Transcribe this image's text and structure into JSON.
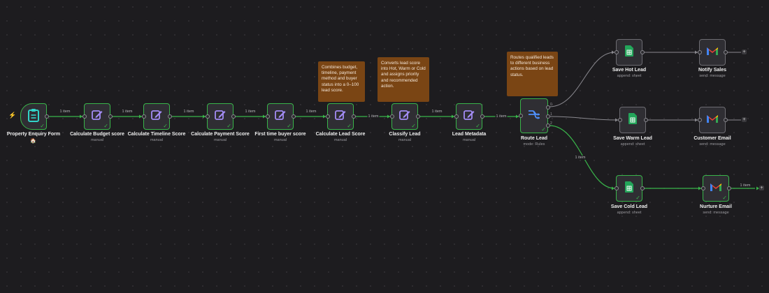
{
  "nodes": {
    "trigger": {
      "label": "Property Enquiry Form",
      "sub": "🏠",
      "icon": "clipboard-icon"
    },
    "budget": {
      "label": "Calculate Budget score",
      "sub": "manual",
      "icon": "pencil-icon"
    },
    "timeline": {
      "label": "Calculate Timeline Score",
      "sub": "manual",
      "icon": "pencil-icon"
    },
    "payment": {
      "label": "Calculate Payment Score",
      "sub": "manual",
      "icon": "pencil-icon"
    },
    "firsttime": {
      "label": "First time buyer score",
      "sub": "manual",
      "icon": "pencil-icon"
    },
    "leadscore": {
      "label": "Calculate Lead Score",
      "sub": "manual",
      "icon": "pencil-icon"
    },
    "classify": {
      "label": "Classify Lead",
      "sub": "manual",
      "icon": "pencil-icon"
    },
    "metadata": {
      "label": "Lead Metadata",
      "sub": "manual",
      "icon": "pencil-icon"
    },
    "route": {
      "label": "Route Lead",
      "sub": "mode: Rules",
      "icon": "switch-icon"
    },
    "savehot": {
      "label": "Save Hot Lead",
      "sub": "append: sheet",
      "icon": "sheets-icon"
    },
    "savewarm": {
      "label": "Save Warm Lead",
      "sub": "append: sheet",
      "icon": "sheets-icon"
    },
    "savecold": {
      "label": "Save Cold Lead",
      "sub": "append: sheet",
      "icon": "sheets-icon"
    },
    "notify": {
      "label": "Notify Sales",
      "sub": "send: message",
      "icon": "gmail-icon"
    },
    "customer": {
      "label": "Customer Email",
      "sub": "send: message",
      "icon": "gmail-icon"
    },
    "nurture": {
      "label": "Nurture Email",
      "sub": "send: message",
      "icon": "gmail-icon"
    }
  },
  "edge_labels": {
    "e1": "1 item",
    "e2": "1 item",
    "e3": "1 item",
    "e4": "1 item",
    "e5": "1 item",
    "e6": "1 item",
    "e7": "1 item",
    "e8": "1 item",
    "cold": "1 item",
    "nurture_out": "1 item"
  },
  "route_ports": [
    "0",
    "1",
    "2"
  ],
  "stickies": {
    "leadscore": "Combines budget, timeline, payment method and buyer status into a 0–100 lead score.",
    "classify": "Converts lead score into Hot, Warm or Cold and assigns priority and recommended action.",
    "route": "Routes qualified leads to different business actions based on lead status."
  },
  "colors": {
    "success": "#39b54a",
    "idle_edge": "#8a898f",
    "sticky": "#7a4514",
    "sheets": "#23a55a",
    "canvas": "#1d1c1f"
  },
  "plus_icon": "+",
  "check_icon": "✓",
  "trigger_icon": "⚡"
}
